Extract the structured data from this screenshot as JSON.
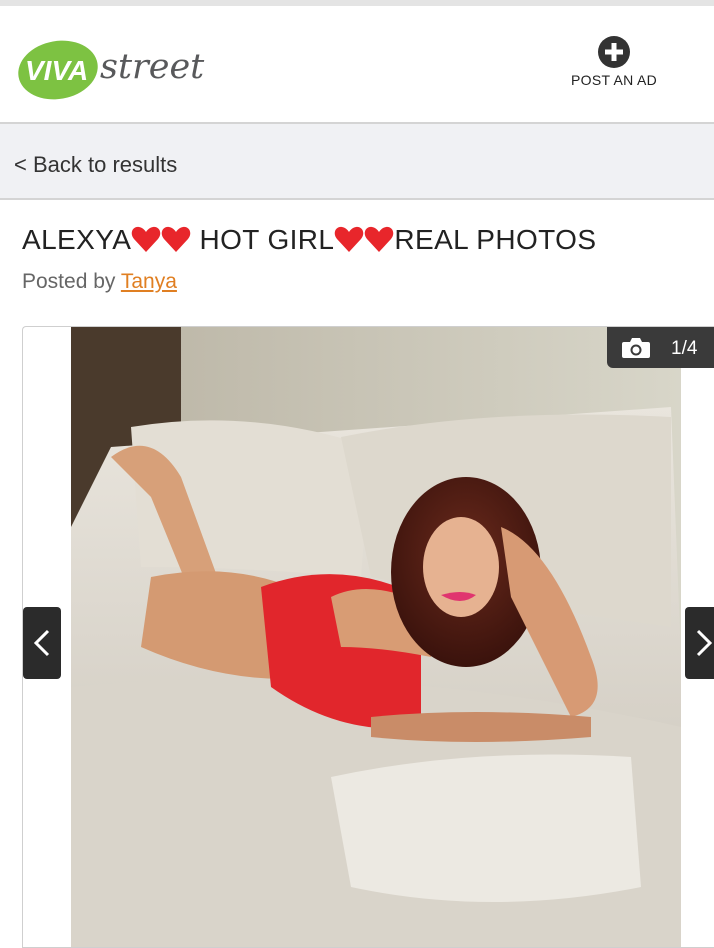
{
  "header": {
    "logo_text_left": "VIVA",
    "logo_text_right": "street",
    "post_ad_label": "POST AN AD"
  },
  "back_link": "< Back to results",
  "listing": {
    "title_parts": [
      "ALEXYA",
      "HOT GIRL",
      "REAL PHOTOS"
    ],
    "posted_by_label": "Posted by",
    "posted_by_user": "Tanya"
  },
  "gallery": {
    "counter": "1/4",
    "current": 1,
    "total": 4
  },
  "colors": {
    "logo_green": "#7dc242",
    "link_orange": "#e07f22",
    "heart_red": "#e8262b",
    "dark_overlay": "#2b2b2b"
  },
  "icons": [
    "plus-circle-icon",
    "camera-icon",
    "chevron-left-icon",
    "chevron-right-icon",
    "heart-icon"
  ]
}
